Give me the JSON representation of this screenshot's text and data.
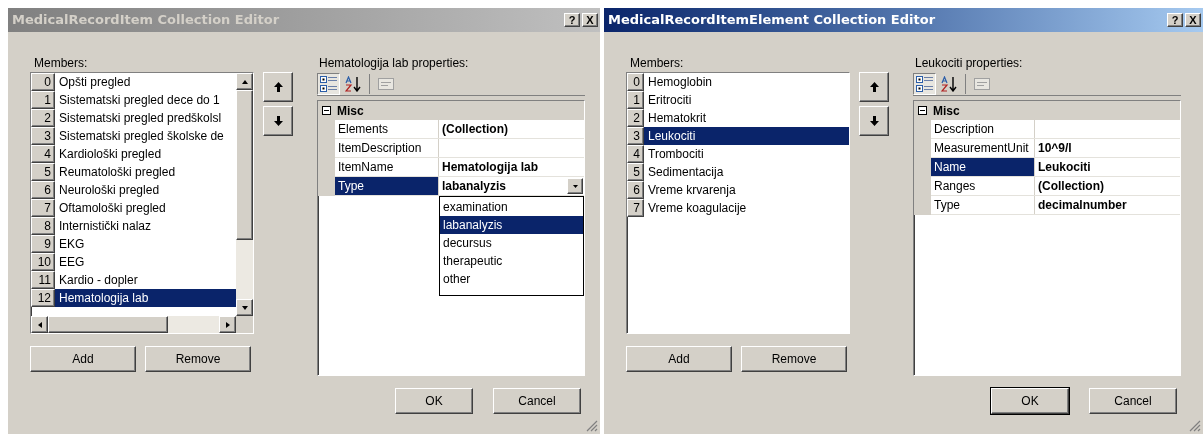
{
  "dialogs": [
    {
      "title": "MedicalRecordItem Collection Editor",
      "active": false,
      "help_button": "?",
      "close_button": "X",
      "members_label": "Members:",
      "scrollable": true,
      "members": [
        {
          "index": "0",
          "name": "Opšti pregled",
          "selected": false
        },
        {
          "index": "1",
          "name": "Sistematski pregled dece do 1",
          "selected": false
        },
        {
          "index": "2",
          "name": "Sistematski pregled predškolsl",
          "selected": false
        },
        {
          "index": "3",
          "name": "Sistematski pregled školske de",
          "selected": false
        },
        {
          "index": "4",
          "name": "Kardiološki pregled",
          "selected": false
        },
        {
          "index": "5",
          "name": "Reumatološki pregled",
          "selected": false
        },
        {
          "index": "6",
          "name": "Neurološki pregled",
          "selected": false
        },
        {
          "index": "7",
          "name": "Oftamološki pregled",
          "selected": false
        },
        {
          "index": "8",
          "name": "Internistički nalaz",
          "selected": false
        },
        {
          "index": "9",
          "name": "EKG",
          "selected": false
        },
        {
          "index": "10",
          "name": "EEG",
          "selected": false
        },
        {
          "index": "11",
          "name": "Kardio - dopler",
          "selected": false
        },
        {
          "index": "12",
          "name": "Hematologija lab",
          "selected": true
        }
      ],
      "add": "Add",
      "remove": "Remove",
      "properties_label": "Hematologija lab properties:",
      "toolbar": [
        {
          "kind": "categorized",
          "selected": true
        },
        {
          "kind": "alphabetical",
          "selected": false
        },
        {
          "kind": "pages",
          "selected": false
        }
      ],
      "category": {
        "name": "Misc",
        "expanded": true
      },
      "properties": [
        {
          "name": "Elements",
          "value": "(Collection)",
          "selected": false
        },
        {
          "name": "ItemDescription",
          "selected": false
        },
        {
          "name": "ItemName",
          "value": "Hematologija lab",
          "selected": false
        },
        {
          "name": "Type",
          "value": "labanalyzis",
          "selected": true,
          "dropdown": [
            {
              "label": "examination",
              "selected": false
            },
            {
              "label": "labanalyzis",
              "selected": true
            },
            {
              "label": "decursus",
              "selected": false
            },
            {
              "label": "therapeutic",
              "selected": false
            },
            {
              "label": "other",
              "selected": false
            }
          ]
        }
      ],
      "ok": "OK",
      "cancel": "Cancel"
    },
    {
      "title": "MedicalRecordItemElement Collection Editor",
      "active": true,
      "help_button": "?",
      "close_button": "X",
      "members_label": "Members:",
      "scrollable": false,
      "members": [
        {
          "index": "0",
          "name": "Hemoglobin",
          "selected": false
        },
        {
          "index": "1",
          "name": "Eritrociti",
          "selected": false
        },
        {
          "index": "2",
          "name": "Hematokrit",
          "selected": false
        },
        {
          "index": "3",
          "name": "Leukociti",
          "selected": true
        },
        {
          "index": "4",
          "name": "Trombociti",
          "selected": false
        },
        {
          "index": "5",
          "name": "Sedimentacija",
          "selected": false
        },
        {
          "index": "6",
          "name": "Vreme krvarenja",
          "selected": false
        },
        {
          "index": "7",
          "name": "Vreme koagulacije",
          "selected": false
        }
      ],
      "add": "Add",
      "remove": "Remove",
      "properties_label": "Leukociti properties:",
      "toolbar": [
        {
          "kind": "categorized",
          "selected": true
        },
        {
          "kind": "alphabetical",
          "selected": false
        },
        {
          "kind": "pages",
          "selected": false
        }
      ],
      "category": {
        "name": "Misc",
        "expanded": true
      },
      "properties": [
        {
          "name": "Description",
          "selected": false
        },
        {
          "name": "MeasurementUnit",
          "value": "10^9/l",
          "selected": false
        },
        {
          "name": "Name",
          "value": "Leukociti",
          "selected": true
        },
        {
          "name": "Ranges",
          "value": "(Collection)",
          "selected": false
        },
        {
          "name": "Type",
          "value": "decimalnumber",
          "selected": false
        }
      ],
      "ok": "OK",
      "cancel": "Cancel"
    }
  ]
}
